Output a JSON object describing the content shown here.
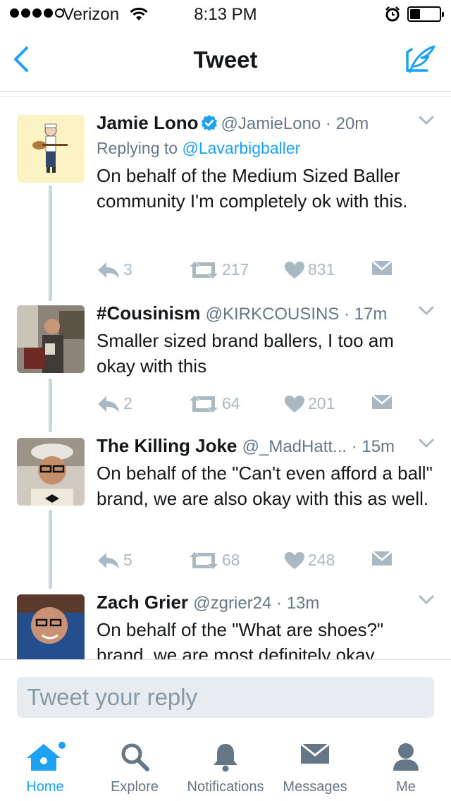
{
  "status_bar": {
    "carrier": "Verizon",
    "time": "8:13 PM",
    "battery_level": 0.35
  },
  "nav": {
    "title": "Tweet"
  },
  "tweets": [
    {
      "name": "Jamie Lono",
      "verified": true,
      "handle": "@JamieLono",
      "time": "20m",
      "replying_prefix": "Replying to",
      "replying_to": "@Lavarbigballer",
      "text": "On behalf of the Medium Sized Baller community I'm completely ok with this.",
      "replies": "3",
      "retweets": "217",
      "likes": "831"
    },
    {
      "name": "#Cousinism",
      "verified": false,
      "handle": "@KIRKCOUSINS",
      "time": "17m",
      "text": "Smaller sized brand ballers, I too am okay with this",
      "replies": "2",
      "retweets": "64",
      "likes": "201"
    },
    {
      "name": "The Killing Joke",
      "verified": false,
      "handle": "@_MadHatt...",
      "time": "15m",
      "text": "On behalf of the \"Can't even afford a ball\" brand, we are also okay with this as well.",
      "replies": "5",
      "retweets": "68",
      "likes": "248"
    },
    {
      "name": "Zach Grier",
      "verified": false,
      "handle": "@zgrier24",
      "time": "13m",
      "text": "On behalf of the \"What are shoes?\" brand, we are most definitely okay"
    }
  ],
  "reply": {
    "placeholder": "Tweet your reply"
  },
  "tabs": [
    {
      "label": "Home",
      "icon": "home-icon",
      "active": true
    },
    {
      "label": "Explore",
      "icon": "search-icon",
      "active": false
    },
    {
      "label": "Notifications",
      "icon": "bell-icon",
      "active": false
    },
    {
      "label": "Messages",
      "icon": "envelope-icon",
      "active": false
    },
    {
      "label": "Me",
      "icon": "person-icon",
      "active": false
    }
  ],
  "colors": {
    "accent": "#1da1f2",
    "icon_gray": "#aab8c2",
    "text_secondary": "#657786"
  }
}
